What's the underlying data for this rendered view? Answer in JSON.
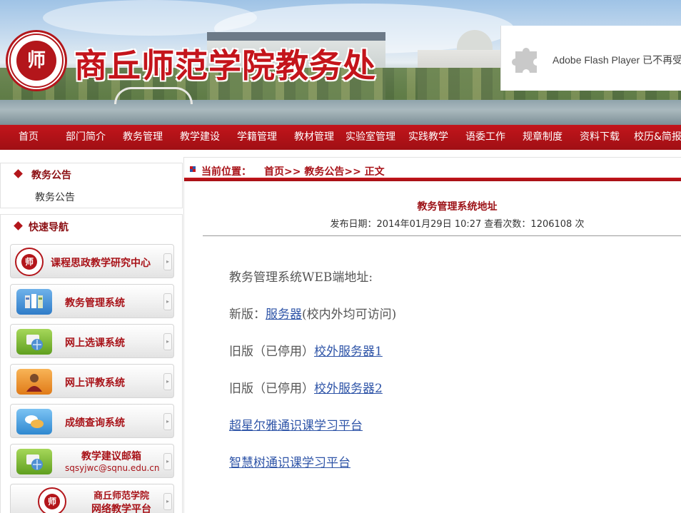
{
  "header": {
    "logo_char": "师",
    "site_title": "商丘师范学院教务处"
  },
  "flash_notice": {
    "text": "Adobe Flash Player 已不再受支持",
    "icon": "puzzle-icon"
  },
  "nav": {
    "items": [
      "首页",
      "部门简介",
      "教务管理",
      "教学建设",
      "学籍管理",
      "教材管理",
      "实验室管理",
      "实践教学",
      "语委工作",
      "规章制度",
      "资料下载",
      "校历&简报"
    ]
  },
  "sidebar": {
    "notice_panel": {
      "title": "教务公告",
      "link": "教务公告"
    },
    "quick_nav": {
      "title": "快速导航",
      "buttons": [
        {
          "label": "课程思政教学研究中心",
          "icon": "school-seal-icon"
        },
        {
          "label": "教务管理系统",
          "icon": "files-icon"
        },
        {
          "label": "网上选课系统",
          "icon": "globe-icon"
        },
        {
          "label": "网上评教系统",
          "icon": "person-icon"
        },
        {
          "label": "成绩查询系统",
          "icon": "chat-icon"
        },
        {
          "label": "教学建议邮箱",
          "sub": "sqsyjwc@sqnu.edu.cn",
          "icon": "globe-icon"
        },
        {
          "label": "商丘师范学院",
          "sub": "网络教学平台",
          "icon": "school-seal-icon"
        }
      ]
    }
  },
  "breadcrumb": {
    "label": "当前位置：",
    "path": "首页>> 教务公告>> 正文"
  },
  "article": {
    "title": "教务管理系统地址",
    "meta": "发布日期：2014年01月29日 10:27      查看次数：1206108  次",
    "line1": "教务管理系统WEB端地址:",
    "line2_prefix": "新版：",
    "line2_link": "服务器",
    "line2_suffix": "(校内外均可访问)",
    "line3_prefix": "旧版（已停用）",
    "line3_link": "校外服务器1",
    "line4_prefix": "旧版（已停用）",
    "line4_link": "校外服务器2",
    "link5": "超星尔雅通识课学习平台",
    "link6": "智慧树通识课学习平台"
  },
  "colors": {
    "brand_red": "#b3161b",
    "link_blue": "#2f55a8"
  }
}
